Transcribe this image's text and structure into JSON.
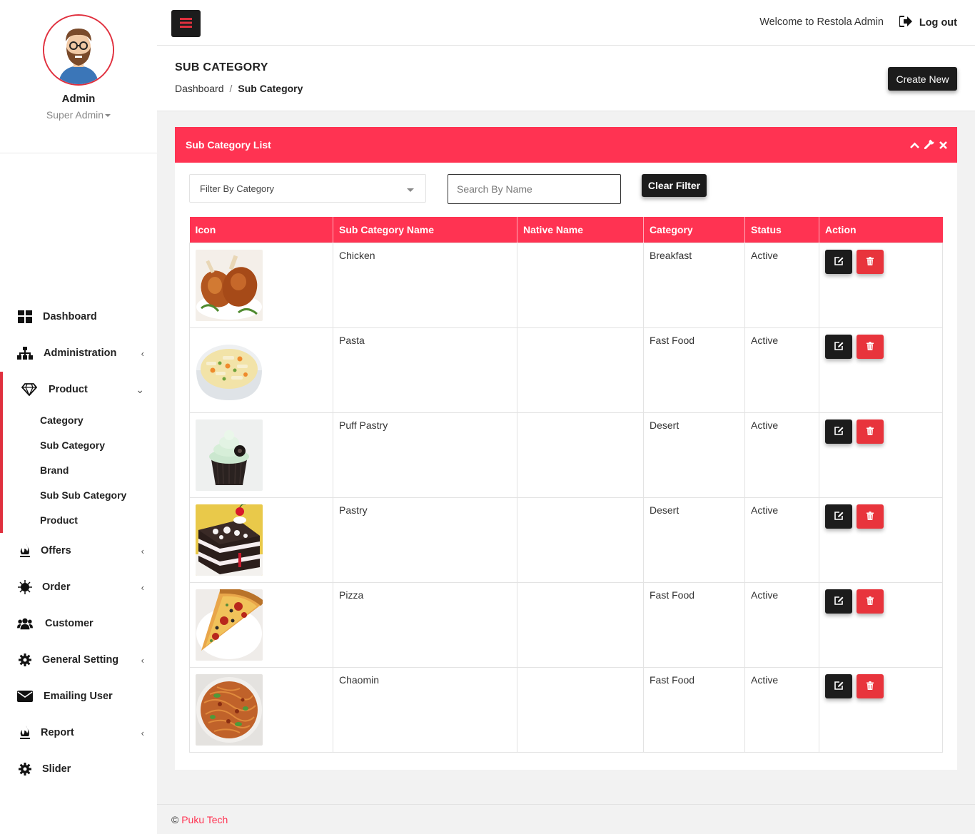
{
  "profile": {
    "name": "Admin",
    "role": "Super Admin"
  },
  "sidebar": {
    "items": [
      {
        "label": "Dashboard",
        "icon": "dashboard-icon"
      },
      {
        "label": "Administration",
        "icon": "sitemap-icon",
        "chevron": "‹"
      },
      {
        "label": "Product",
        "icon": "diamond-icon",
        "chevron": "⌄"
      },
      {
        "label": "Offers",
        "icon": "fire-icon",
        "chevron": "‹"
      },
      {
        "label": "Order",
        "icon": "snowflake-icon",
        "chevron": "‹"
      },
      {
        "label": "Customer",
        "icon": "users-icon"
      },
      {
        "label": "General Setting",
        "icon": "gear-icon",
        "chevron": "‹"
      },
      {
        "label": "Emailing User",
        "icon": "envelope-icon"
      },
      {
        "label": "Report",
        "icon": "fire-icon",
        "chevron": "‹"
      },
      {
        "label": "Slider",
        "icon": "gear-icon"
      }
    ],
    "product_sub": [
      "Category",
      "Sub Category",
      "Brand",
      "Sub Sub Category",
      "Product"
    ]
  },
  "header": {
    "welcome": "Welcome to Restola Admin",
    "logout": "Log out"
  },
  "page": {
    "title": "SUB CATEGORY",
    "breadcrumb_home": "Dashboard",
    "breadcrumb_sep": "/",
    "breadcrumb_current": "Sub Category",
    "create_label": "Create New"
  },
  "card": {
    "title": "Sub Category List"
  },
  "filters": {
    "category_placeholder": "Filter By Category",
    "search_placeholder": "Search By Name",
    "clear_label": "Clear Filter"
  },
  "table": {
    "columns": [
      "Icon",
      "Sub Category Name",
      "Native Name",
      "Category",
      "Status",
      "Action"
    ],
    "rows": [
      {
        "name": "Chicken",
        "native": "",
        "category": "Breakfast",
        "status": "Active",
        "image": "chicken"
      },
      {
        "name": "Pasta",
        "native": "",
        "category": "Fast Food",
        "status": "Active",
        "image": "pasta"
      },
      {
        "name": "Puff Pastry",
        "native": "",
        "category": "Desert",
        "status": "Active",
        "image": "cupcake"
      },
      {
        "name": "Pastry",
        "native": "",
        "category": "Desert",
        "status": "Active",
        "image": "cake"
      },
      {
        "name": "Pizza",
        "native": "",
        "category": "Fast Food",
        "status": "Active",
        "image": "pizza"
      },
      {
        "name": "Chaomin",
        "native": "",
        "category": "Fast Food",
        "status": "Active",
        "image": "noodles"
      }
    ]
  },
  "footer": {
    "symbol": "©",
    "brand": "Puku Tech"
  },
  "colors": {
    "accent": "#ff3352",
    "dark": "#1c1c1c",
    "delete": "#e8343c"
  }
}
